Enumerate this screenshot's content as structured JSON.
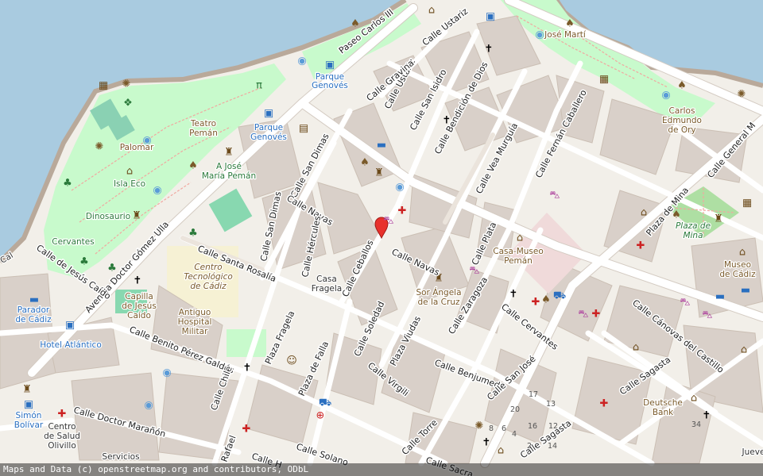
{
  "colors": {
    "water": "#a9cbe0",
    "land": "#f2efe9",
    "block": "#d9d0c9",
    "park": "#c8facc",
    "park_dark": "#aedfa3",
    "road": "#ffffff",
    "road_casing": "#d4cbc2",
    "pedestrian": "#ebe4dc",
    "building": "#d0c6bc",
    "marker": "#e8312c",
    "plaza": "#f0dada"
  },
  "attribution": "Maps and Data (c) openstreetmap.org and contributors, ODbL",
  "pois": {
    "jose_marti": "José Martí",
    "parque_genoves_1": "Parque",
    "parque_genoves_2": "Genovés",
    "parque_genoves_3": "Parque",
    "parque_genoves_4": "Genovés",
    "teatro_1": "Teatro",
    "teatro_2": "Pemán",
    "palomar": "Palomar",
    "isla_eco": "Isla Eco",
    "a_jose_1": "A José",
    "a_jose_2": "María Pemán",
    "dinosaurio": "Dinosaurio",
    "cervantes": "Cervantes",
    "carlos_1": "Carlos",
    "carlos_2": "Edmundo",
    "carlos_3": "de Ory",
    "centro_1": "Centro",
    "centro_2": "Tecnológico",
    "centro_3": "de Cádiz",
    "capilla_1": "Capilla",
    "capilla_2": "de Jesús",
    "capilla_3": "Caído",
    "parador_1": "Parador",
    "parador_2": "de Cádiz",
    "hotel": "Hotel Atlántico",
    "antiguo_1": "Antiguo",
    "antiguo_2": "Hospital",
    "antiguo_3": "Militar",
    "casa_1": "Casa",
    "casa_2": "Fragela",
    "casa_museo_1": "Casa-Museo",
    "casa_museo_2": "Pemán",
    "sor_1": "Sor Ángela",
    "sor_2": "de la Cruz",
    "plaza_mina_1": "Plaza de",
    "plaza_mina_2": "Mina",
    "museo_1": "Museo",
    "museo_2": "de Cádiz",
    "deutsche_1": "Deutsche",
    "deutsche_2": "Bank",
    "simon_1": "Simón",
    "simon_2": "Bolívar",
    "salud_1": "Centro",
    "salud_2": "de Salud",
    "salud_3": "Olivillo",
    "servicios": "Servicios",
    "jueve": "Jueve",
    "cal": "Cal"
  },
  "streets": {
    "paseo_carlos": "Paseo Carlos III",
    "ustariz_1": "Calle Ustariz",
    "ustariz_2": "Calle Ustariz",
    "gravina": "Calle Gravina",
    "san_isidro": "Calle San Isidro",
    "bendicion": "Calle Bendición de Dios",
    "vea_murguia": "Calle Vea Murguía",
    "fernan": "Calle Fernán Caballero",
    "general": "Calle General M",
    "plaza_mina": "Plaza de Mina",
    "san_dimas_1": "Calle San Dimas",
    "san_dimas_2": "Calle San Dimas",
    "navas_1": "Calle Navas",
    "navas_2": "Calle Navas",
    "hercules": "Calle Hércules",
    "ceballos": "Calle Ceballos",
    "plata": "Calle Plata",
    "santa_rosalia": "Calle Santa Rosalía",
    "gomez_ulla": "Avenida Doctor Gómez Ulla",
    "jesus_caido": "Calle de Jesús Caído",
    "benito": "Calle Benito Pérez Galdós",
    "fragela": "Plaza Fragela",
    "falla": "Plaza de Falla",
    "soledad": "Calle Soledad",
    "zaragoza": "Calle Zaragoza",
    "cervantes": "Calle Cervantes",
    "canovas": "Calle Cánovas del Castillo",
    "benjumeda": "Calle Benjumeda",
    "san_jose": "Calle San José",
    "virgili": "Calle Virgili",
    "viudas": "Plaza Viudas",
    "sagasta_1": "Calle Sagasta",
    "sagasta_2": "Calle Sagasta",
    "chile": "Calle Chile",
    "maranon": "Calle Doctor Marañón",
    "torre": "Calle Torre",
    "solano": "Calle Solano",
    "sacra": "Calle Sacra",
    "rafael": "Rafael",
    "calle_h": "Calle H"
  },
  "house_numbers": [
    "17",
    "13",
    "20",
    "16",
    "12",
    "8",
    "6",
    "4",
    "2",
    "14",
    "34"
  ],
  "icons": {
    "marker": "map-pin-marker",
    "church": "church-cross-icon",
    "pharmacy": "pharmacy-cross-icon",
    "bus": "bus-stop-icon",
    "museum": "museum-icon",
    "shop": "shopping-cart-icon",
    "bank": "bank-icon",
    "library": "library-book-icon",
    "theatre": "theatre-masks-icon",
    "hotel": "hotel-bed-icon",
    "fountain": "fountain-icon",
    "monument": "monument-icon",
    "playground": "playground-icon",
    "picnic": "picnic-table-icon",
    "dog": "dog-park-icon",
    "taxi": "taxi-icon",
    "tree": "tree-icon",
    "sun": "viewpoint-icon"
  }
}
